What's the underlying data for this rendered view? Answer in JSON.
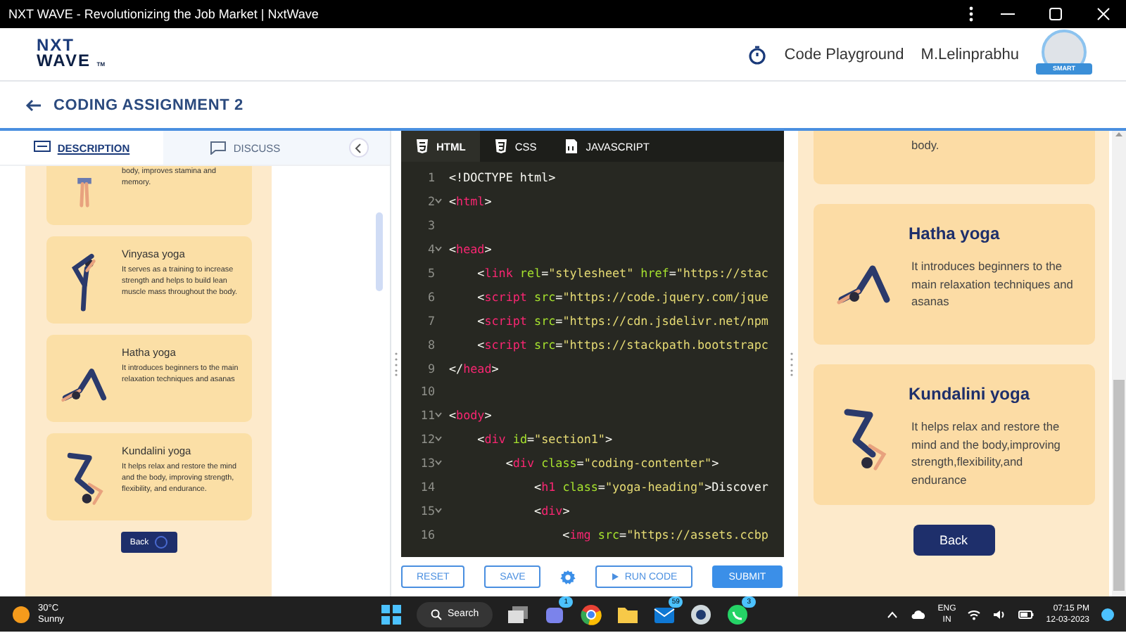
{
  "window": {
    "title": "NXT WAVE - Revolutionizing the Job Market | NxtWave"
  },
  "header": {
    "logo": {
      "line1": "NXT",
      "line2": "WAVE",
      "mark": "TM"
    },
    "link": "Code Playground",
    "user": "M.Lelinprabhu",
    "badge": "SMART"
  },
  "page": {
    "title": "CODING ASSIGNMENT 2"
  },
  "left_panel": {
    "tabs": [
      {
        "label": "DESCRIPTION",
        "kind": "description",
        "selected": true
      },
      {
        "label": "DISCUSS",
        "kind": "discuss",
        "selected": false
      }
    ],
    "cards": [
      {
        "kind": "standing",
        "description": "body, improves stamina and memory."
      },
      {
        "kind": "balance",
        "title": "Vinyasa yoga",
        "description": "It serves as a training to increase strength and helps to build lean muscle mass throughout the body."
      },
      {
        "kind": "downward",
        "title": "Hatha yoga",
        "description": "It introduces beginners to the main relaxation techniques and asanas"
      },
      {
        "kind": "inverted",
        "title": "Kundalini yoga",
        "description": "It helps relax and restore the mind and the body, improving strength, flexibility, and endurance."
      }
    ],
    "back_button": "Back"
  },
  "editor": {
    "tabs": [
      {
        "label": "HTML",
        "kind": "html",
        "selected": true
      },
      {
        "label": "CSS",
        "kind": "css",
        "selected": false
      },
      {
        "label": "JAVASCRIPT",
        "kind": "js",
        "selected": false
      }
    ],
    "lines": [
      {
        "number": "1",
        "foldable": false,
        "tokens": [
          {
            "kind": "text",
            "text": "<!DOCTYPE html>"
          }
        ]
      },
      {
        "number": "2",
        "foldable": true,
        "tokens": [
          {
            "kind": "punct",
            "text": "<"
          },
          {
            "kind": "tag",
            "text": "html"
          },
          {
            "kind": "punct",
            "text": ">"
          }
        ]
      },
      {
        "number": "3",
        "foldable": false
      },
      {
        "number": "4",
        "foldable": true,
        "tokens": [
          {
            "kind": "punct",
            "text": "<"
          },
          {
            "kind": "tag",
            "text": "head"
          },
          {
            "kind": "punct",
            "text": ">"
          }
        ]
      },
      {
        "number": "5",
        "foldable": false,
        "tokens": [
          {
            "kind": "punct",
            "text": "    <"
          },
          {
            "kind": "tag",
            "text": "link"
          },
          {
            "kind": "attr",
            "text": " rel"
          },
          {
            "kind": "punct",
            "text": "="
          },
          {
            "kind": "string",
            "text": "\"stylesheet\""
          },
          {
            "kind": "attr",
            "text": " href"
          },
          {
            "kind": "punct",
            "text": "="
          },
          {
            "kind": "string",
            "text": "\"https://stac"
          }
        ]
      },
      {
        "number": "6",
        "foldable": false,
        "tokens": [
          {
            "kind": "punct",
            "text": "    <"
          },
          {
            "kind": "tag",
            "text": "script"
          },
          {
            "kind": "attr",
            "text": " src"
          },
          {
            "kind": "punct",
            "text": "="
          },
          {
            "kind": "string",
            "text": "\"https://code.jquery.com/jque"
          }
        ]
      },
      {
        "number": "7",
        "foldable": false,
        "tokens": [
          {
            "kind": "punct",
            "text": "    <"
          },
          {
            "kind": "tag",
            "text": "script"
          },
          {
            "kind": "attr",
            "text": " src"
          },
          {
            "kind": "punct",
            "text": "="
          },
          {
            "kind": "string",
            "text": "\"https://cdn.jsdelivr.net/npm"
          }
        ]
      },
      {
        "number": "8",
        "foldable": false,
        "tokens": [
          {
            "kind": "punct",
            "text": "    <"
          },
          {
            "kind": "tag",
            "text": "script"
          },
          {
            "kind": "attr",
            "text": " src"
          },
          {
            "kind": "punct",
            "text": "="
          },
          {
            "kind": "string",
            "text": "\"https://stackpath.bootstrapc"
          }
        ]
      },
      {
        "number": "9",
        "foldable": false,
        "tokens": [
          {
            "kind": "punct",
            "text": "</"
          },
          {
            "kind": "tag",
            "text": "head"
          },
          {
            "kind": "punct",
            "text": ">"
          }
        ]
      },
      {
        "number": "10",
        "foldable": false
      },
      {
        "number": "11",
        "foldable": true,
        "tokens": [
          {
            "kind": "punct",
            "text": "<"
          },
          {
            "kind": "tag",
            "text": "body"
          },
          {
            "kind": "punct",
            "text": ">"
          }
        ]
      },
      {
        "number": "12",
        "foldable": true,
        "tokens": [
          {
            "kind": "punct",
            "text": "    <"
          },
          {
            "kind": "tag",
            "text": "div"
          },
          {
            "kind": "attr",
            "text": " id"
          },
          {
            "kind": "punct",
            "text": "="
          },
          {
            "kind": "string",
            "text": "\"section1\""
          },
          {
            "kind": "punct",
            "text": ">"
          }
        ]
      },
      {
        "number": "13",
        "foldable": true,
        "tokens": [
          {
            "kind": "punct",
            "text": "        <"
          },
          {
            "kind": "tag",
            "text": "div"
          },
          {
            "kind": "attr",
            "text": " class"
          },
          {
            "kind": "punct",
            "text": "="
          },
          {
            "kind": "string",
            "text": "\"coding-contenter\""
          },
          {
            "kind": "punct",
            "text": ">"
          }
        ]
      },
      {
        "number": "14",
        "foldable": false,
        "tokens": [
          {
            "kind": "punct",
            "text": "            <"
          },
          {
            "kind": "tag",
            "text": "h1"
          },
          {
            "kind": "attr",
            "text": " class"
          },
          {
            "kind": "punct",
            "text": "="
          },
          {
            "kind": "string",
            "text": "\"yoga-heading\""
          },
          {
            "kind": "punct",
            "text": ">Discover"
          }
        ]
      },
      {
        "number": "15",
        "foldable": true,
        "tokens": [
          {
            "kind": "punct",
            "text": "            <"
          },
          {
            "kind": "tag",
            "text": "div"
          },
          {
            "kind": "punct",
            "text": ">"
          }
        ]
      },
      {
        "number": "16",
        "foldable": false,
        "tokens": [
          {
            "kind": "punct",
            "text": "                <"
          },
          {
            "kind": "tag",
            "text": "img"
          },
          {
            "kind": "attr",
            "text": " src"
          },
          {
            "kind": "punct",
            "text": "="
          },
          {
            "kind": "string",
            "text": "\"https://assets.ccbp"
          }
        ]
      }
    ],
    "buttons": [
      {
        "label": "RESET",
        "kind": "reset"
      },
      {
        "label": "SAVE",
        "kind": "save"
      },
      {
        "kind": "settings"
      },
      {
        "label": "RUN CODE",
        "kind": "run"
      },
      {
        "label": "SUBMIT",
        "kind": "submit"
      }
    ]
  },
  "preview": {
    "cards": [
      {
        "description": "body."
      },
      {
        "kind": "downward",
        "title": "Hatha yoga",
        "description": "It introduces beginners to the main relaxation techniques and asanas"
      },
      {
        "kind": "inverted",
        "title": "Kundalini yoga",
        "description": "It helps relax and restore the mind and the body,improving strength,flexibility,and endurance"
      }
    ],
    "back_button": "Back"
  },
  "taskbar": {
    "weather": {
      "temperature": "30°C",
      "condition": "Sunny"
    },
    "search": "Search",
    "apps": [
      {
        "kind": "start"
      },
      {
        "kind": "search"
      },
      {
        "kind": "windows"
      },
      {
        "kind": "chat",
        "badge": "1"
      },
      {
        "kind": "browser"
      },
      {
        "kind": "folder"
      },
      {
        "kind": "mail",
        "badge": "59"
      },
      {
        "kind": "app"
      },
      {
        "kind": "whatsapp",
        "badge": "3"
      }
    ],
    "language": "ENG",
    "region": "IN",
    "time": "07:15 PM",
    "date": "12-03-2023"
  }
}
